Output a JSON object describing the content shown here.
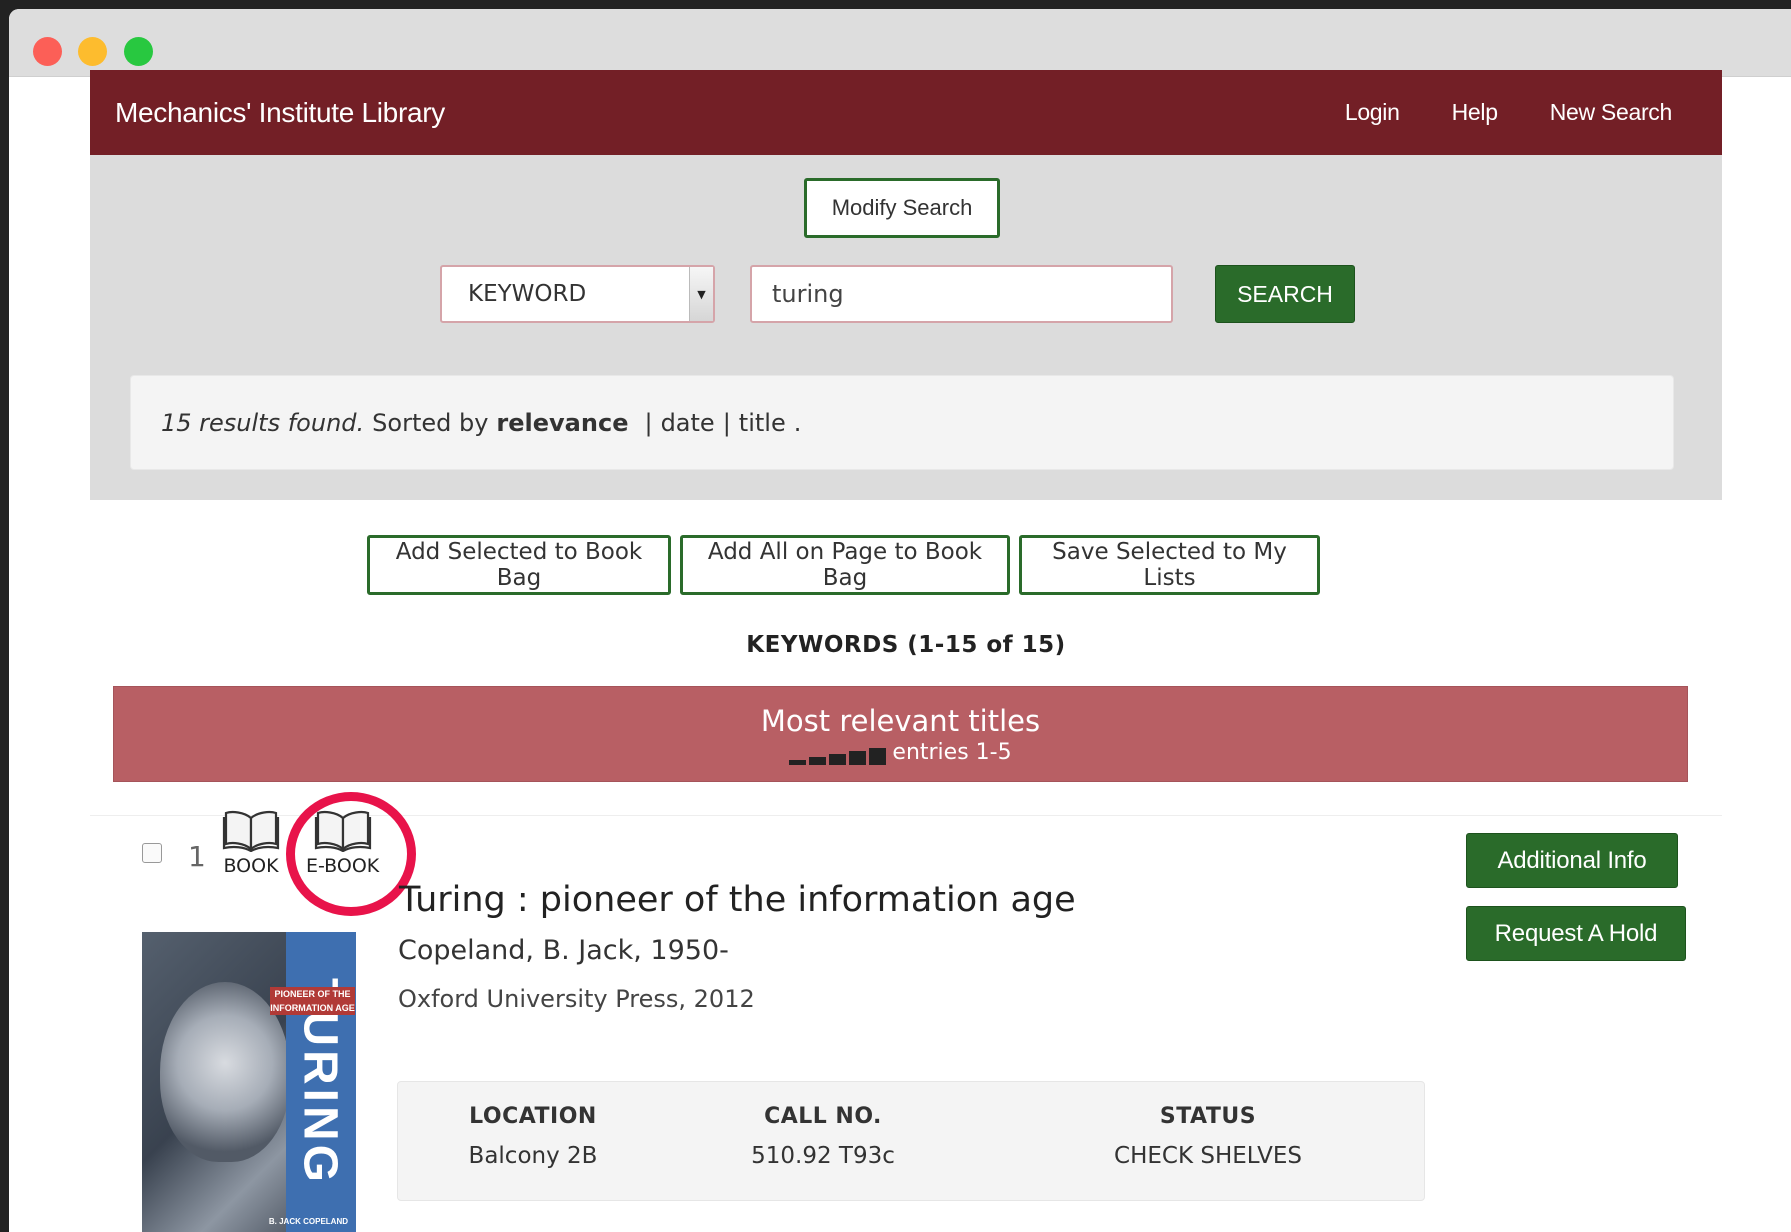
{
  "header": {
    "brand": "Mechanics' Institute Library",
    "nav": {
      "login": "Login",
      "help": "Help",
      "new_search": "New Search"
    }
  },
  "search": {
    "modify_label": "Modify Search",
    "type_selected": "KEYWORD",
    "query": "turing",
    "submit_label": "SEARCH"
  },
  "results": {
    "found_text": "15 results found.",
    "sorted_by": "Sorted by",
    "sort_relevance": "relevance",
    "sort_date": "date",
    "sort_title": "title",
    "sep": "|",
    "end": "."
  },
  "actions": {
    "add_selected": "Add Selected to Book Bag",
    "add_all": "Add All on Page to Book Bag",
    "save_selected": "Save Selected to My Lists"
  },
  "keywords_heading": "KEYWORDS (1-15 of 15)",
  "relevance": {
    "title": "Most relevant titles",
    "entries": "entries 1-5"
  },
  "record": {
    "number": "1",
    "formats": [
      "BOOK",
      "E-BOOK"
    ],
    "title": "Turing : pioneer of the information age",
    "author": "Copeland, B. Jack, 1950-",
    "publisher": "Oxford University Press, 2012",
    "cover": {
      "big_text": "TURING",
      "subtitle_1": "PIONEER OF THE",
      "subtitle_2": "INFORMATION AGE",
      "author": "B. JACK COPELAND"
    },
    "buttons": {
      "info": "Additional Info",
      "hold": "Request A Hold"
    },
    "holdings": {
      "headers": [
        "LOCATION",
        "CALL NO.",
        "STATUS"
      ],
      "values": [
        "Balcony 2B",
        "510.92 T93c",
        "CHECK SHELVES"
      ]
    }
  },
  "colors": {
    "header_bg": "#731f26",
    "green": "#2a6b2a",
    "relevance_bar": "#b85f64",
    "highlight": "#e8134a"
  }
}
